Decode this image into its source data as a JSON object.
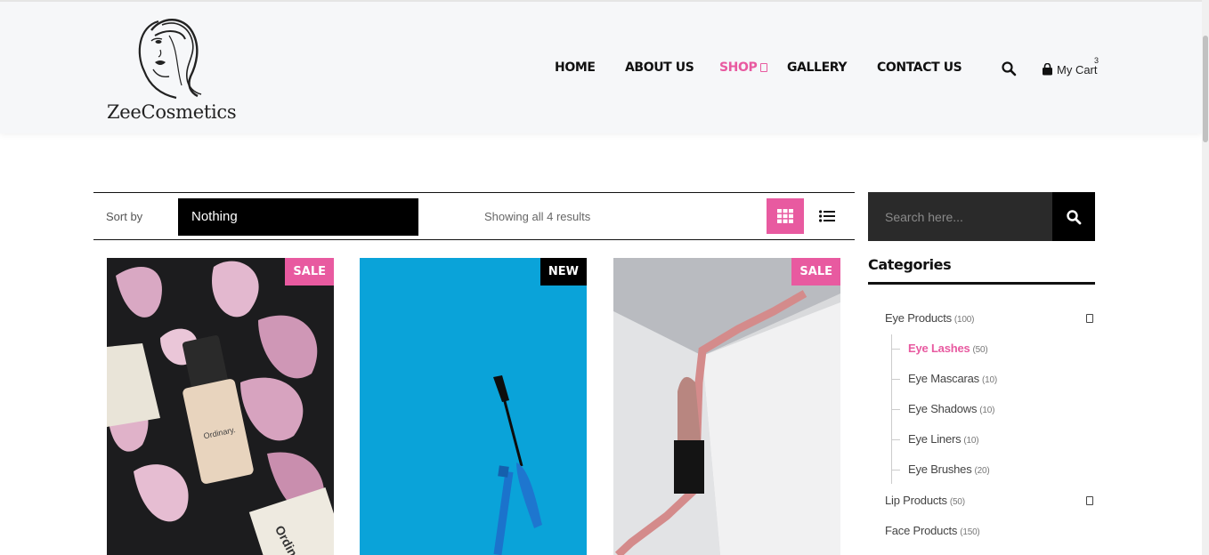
{
  "brand": {
    "name": "ZeeCosmetics",
    "accent": "#e85aa0"
  },
  "nav": {
    "items": [
      {
        "label": "HOME"
      },
      {
        "label": "ABOUT US"
      },
      {
        "label": "SHOP",
        "active": true
      },
      {
        "label": "GALLERY"
      },
      {
        "label": "CONTACT US"
      }
    ],
    "search_icon": "search-icon",
    "cart": {
      "label": "My Cart",
      "count": "3",
      "icon": "shopping-bag-icon"
    }
  },
  "toolbar": {
    "sort_label": "Sort by",
    "sort_value": "Nothing",
    "results_text": "Showing all 4 results",
    "grid_icon": "grid-view-icon",
    "list_icon": "list-view-icon"
  },
  "products": [
    {
      "badge": "SALE",
      "image": "foundation-bottle-with-peony-petals"
    },
    {
      "badge": "NEW",
      "image": "blue-mascara-on-blue-background"
    },
    {
      "badge": "SALE",
      "image": "lipstick-on-white-steps"
    }
  ],
  "sidebar": {
    "search_placeholder": "Search here...",
    "categories_title": "Categories",
    "categories": [
      {
        "label": "Eye Products",
        "count": "(100)",
        "level": 0,
        "expandable": true
      },
      {
        "label": "Eye Lashes",
        "count": "(50)",
        "level": 1,
        "active": true
      },
      {
        "label": "Eye Mascaras",
        "count": "(10)",
        "level": 1
      },
      {
        "label": "Eye Shadows",
        "count": "(10)",
        "level": 1
      },
      {
        "label": "Eye Liners",
        "count": "(10)",
        "level": 1
      },
      {
        "label": "Eye Brushes",
        "count": "(20)",
        "level": 1
      },
      {
        "label": "Lip Products",
        "count": "(50)",
        "level": 0,
        "expandable": true
      },
      {
        "label": "Face Products",
        "count": "(150)",
        "level": 0
      }
    ]
  }
}
